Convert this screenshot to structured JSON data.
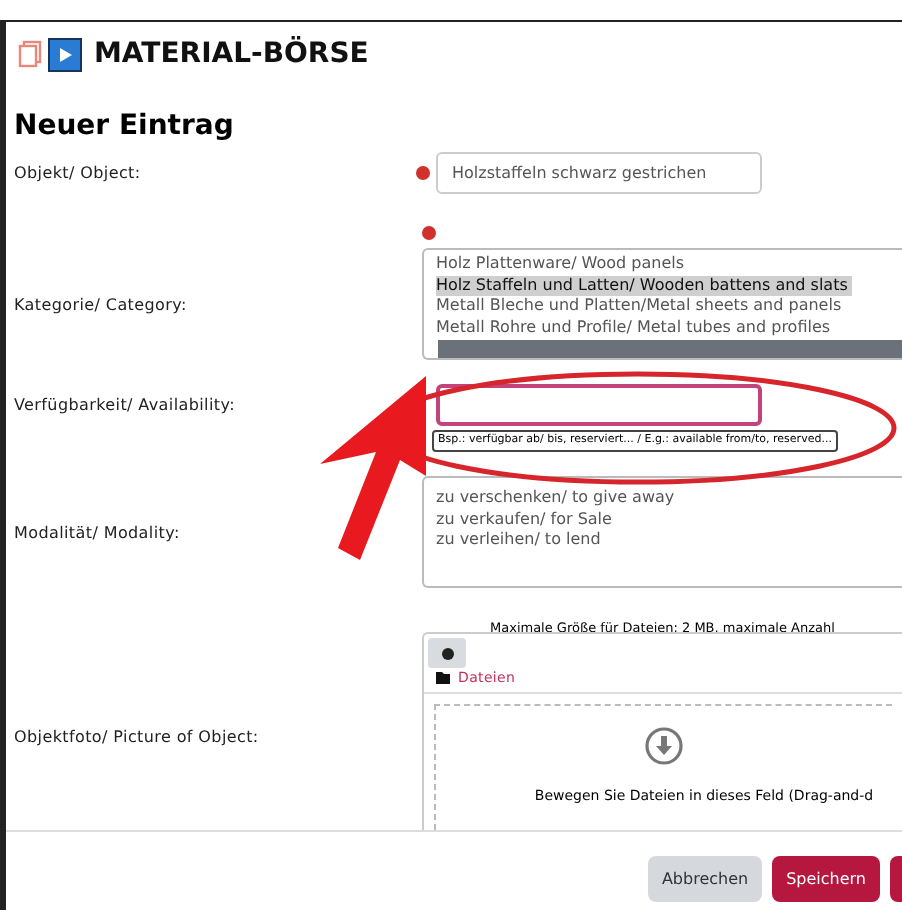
{
  "header": {
    "title": "MATERIAL-BÖRSE"
  },
  "heading": "Neuer Eintrag",
  "fields": [
    {
      "kind": "text",
      "label": "Objekt/ Object:",
      "required": true,
      "value": "Holzstaffeln schwarz gestrichen"
    },
    {
      "kind": "list",
      "label": "Kategorie/ Category:",
      "required": true,
      "options": [
        {
          "label": "Holz Plattenware/ Wood panels",
          "selected": false
        },
        {
          "label": "Holz Staffeln und Latten/ Wooden battens and slats",
          "selected": true
        },
        {
          "label": "Metall Bleche und Platten/Metal sheets and panels",
          "selected": false
        },
        {
          "label": "Metall Rohre und Profile/ Metal tubes and profiles",
          "selected": false
        }
      ]
    },
    {
      "kind": "text",
      "label": "Verfügbarkeit/ Availability:",
      "focused": true,
      "tooltip": "Bsp.: verfügbar ab/ bis, reserviert... / E.g.: available from/to, reserved..."
    },
    {
      "kind": "list",
      "label": "Modalität/ Modality:",
      "options": [
        {
          "label": "zu verschenken/ to give away",
          "selected": false
        },
        {
          "label": "zu verkaufen/ for Sale",
          "selected": false
        },
        {
          "label": "zu verleihen/ to lend",
          "selected": false
        }
      ]
    },
    {
      "kind": "upload",
      "label": "Objektfoto/ Picture of Object:",
      "note": "Maximale Größe für Dateien: 2 MB, maximale Anzahl",
      "folder": "Dateien",
      "drop_hint": "Bewegen Sie Dateien in dieses Feld (Drag-and-d"
    }
  ],
  "buttons": [
    {
      "label": "Abbrechen",
      "kind": "secondary"
    },
    {
      "label": "Speichern",
      "kind": "primary"
    },
    {
      "kind": "primary"
    }
  ]
}
